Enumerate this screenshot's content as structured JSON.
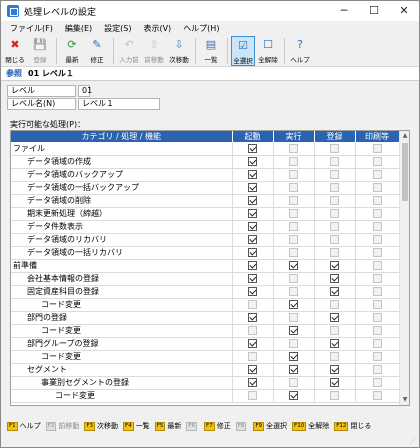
{
  "window": {
    "title": "処理レベルの設定",
    "minimize": "─",
    "maximize": "☐",
    "close": "✕"
  },
  "menu": [
    "ファイル(F)",
    "編集(E)",
    "設定(S)",
    "表示(V)",
    "ヘルプ(H)"
  ],
  "toolbar": [
    {
      "label": "閉じる",
      "icon": "close-icon",
      "glyph": "✖",
      "color": "#d22",
      "state": "enabled"
    },
    {
      "label": "登録",
      "icon": "save-icon",
      "glyph": "💾",
      "color": "#888",
      "state": "disabled"
    },
    {
      "label": "最新",
      "icon": "refresh-icon",
      "glyph": "⟳",
      "color": "#2a9a3a",
      "state": "enabled"
    },
    {
      "label": "修正",
      "icon": "edit-icon",
      "glyph": "✎",
      "color": "#2a6fc0",
      "state": "enabled"
    },
    {
      "label": "入力前",
      "icon": "undo-icon",
      "glyph": "↶",
      "color": "#888",
      "state": "disabled"
    },
    {
      "label": "前移動",
      "icon": "arrow-up-icon",
      "glyph": "⇧",
      "color": "#888",
      "state": "disabled"
    },
    {
      "label": "次移動",
      "icon": "arrow-down-icon",
      "glyph": "⇩",
      "color": "#2a8fd0",
      "state": "enabled"
    },
    {
      "label": "一覧",
      "icon": "list-icon",
      "glyph": "▤",
      "color": "#3a6fb0",
      "state": "enabled"
    },
    {
      "label": "全選択",
      "icon": "select-all-icon",
      "glyph": "☑",
      "color": "#2a6fc0",
      "state": "pressed"
    },
    {
      "label": "全解除",
      "icon": "deselect-all-icon",
      "glyph": "☐",
      "color": "#2a6fc0",
      "state": "enabled"
    },
    {
      "label": "ヘルプ",
      "icon": "help-icon",
      "glyph": "?",
      "color": "#2a6fc0",
      "state": "enabled"
    }
  ],
  "subheader": {
    "mode": "参照",
    "value": "01  レベル１"
  },
  "form": {
    "level_label": "レベル",
    "level_value": "01",
    "level_name_label": "レベル名(N)",
    "level_name_value": "レベル１"
  },
  "section_label": "実行可能な処理(P)：",
  "grid": {
    "columns": [
      "カテゴリ / 処理 / 機能",
      "起動",
      "実行",
      "登録",
      "印刷等"
    ],
    "rows": [
      {
        "name": "ファイル",
        "indent": 0,
        "cells": [
          "on",
          "dis",
          "dis",
          "dis"
        ]
      },
      {
        "name": "データ領域の作成",
        "indent": 1,
        "cells": [
          "on",
          "dis",
          "dis",
          "dis"
        ]
      },
      {
        "name": "データ領域のバックアップ",
        "indent": 1,
        "cells": [
          "on",
          "dis",
          "dis",
          "dis"
        ]
      },
      {
        "name": "データ領域の一括バックアップ",
        "indent": 1,
        "cells": [
          "on",
          "dis",
          "dis",
          "dis"
        ]
      },
      {
        "name": "データ領域の削除",
        "indent": 1,
        "cells": [
          "on",
          "dis",
          "dis",
          "dis"
        ]
      },
      {
        "name": "期末更新処理（締越）",
        "indent": 1,
        "cells": [
          "on",
          "dis",
          "dis",
          "dis"
        ]
      },
      {
        "name": "データ件数表示",
        "indent": 1,
        "cells": [
          "on",
          "dis",
          "dis",
          "dis"
        ]
      },
      {
        "name": "データ領域のリカバリ",
        "indent": 1,
        "cells": [
          "on",
          "dis",
          "dis",
          "dis"
        ]
      },
      {
        "name": "データ領域の一括リカバリ",
        "indent": 1,
        "cells": [
          "on",
          "dis",
          "dis",
          "dis"
        ]
      },
      {
        "name": "前準備",
        "indent": 0,
        "cells": [
          "on",
          "on",
          "on",
          "dis"
        ]
      },
      {
        "name": "会社基本情報の登録",
        "indent": 1,
        "cells": [
          "on",
          "dis",
          "on",
          "dis"
        ]
      },
      {
        "name": "固定資産科目の登録",
        "indent": 1,
        "cells": [
          "on",
          "dis",
          "on",
          "dis"
        ]
      },
      {
        "name": "コード変更",
        "indent": 2,
        "cells": [
          "dis",
          "on",
          "dis",
          "dis"
        ]
      },
      {
        "name": "部門の登録",
        "indent": 1,
        "cells": [
          "on",
          "dis",
          "on",
          "dis"
        ]
      },
      {
        "name": "コード変更",
        "indent": 2,
        "cells": [
          "dis",
          "on",
          "dis",
          "dis"
        ]
      },
      {
        "name": "部門グループの登録",
        "indent": 1,
        "cells": [
          "on",
          "dis",
          "on",
          "dis"
        ]
      },
      {
        "name": "コード変更",
        "indent": 2,
        "cells": [
          "dis",
          "on",
          "dis",
          "dis"
        ]
      },
      {
        "name": "セグメント",
        "indent": 1,
        "cells": [
          "on",
          "on",
          "on",
          "dis"
        ]
      },
      {
        "name": "事業別セグメントの登録",
        "indent": 2,
        "cells": [
          "on",
          "dis",
          "on",
          "dis"
        ]
      },
      {
        "name": "コード変更",
        "indent": 3,
        "cells": [
          "dis",
          "on",
          "dis",
          "dis"
        ]
      }
    ]
  },
  "fkeys": [
    {
      "key": "F1",
      "label": "ヘルプ",
      "state": "enabled"
    },
    {
      "key": "F2",
      "label": "前移動",
      "state": "disabled"
    },
    {
      "key": "F3",
      "label": "次移動",
      "state": "enabled"
    },
    {
      "key": "F4",
      "label": "一覧",
      "state": "enabled"
    },
    {
      "key": "F5",
      "label": "最新",
      "state": "enabled"
    },
    {
      "key": "F6",
      "label": "",
      "state": "disabled"
    },
    {
      "key": "F7",
      "label": "修正",
      "state": "enabled"
    },
    {
      "key": "F8",
      "label": "",
      "state": "disabled"
    },
    {
      "key": "F9",
      "label": "全選択",
      "state": "enabled"
    },
    {
      "key": "F10",
      "label": "全解除",
      "state": "enabled"
    },
    {
      "key": "F12",
      "label": "閉じる",
      "state": "enabled"
    }
  ]
}
